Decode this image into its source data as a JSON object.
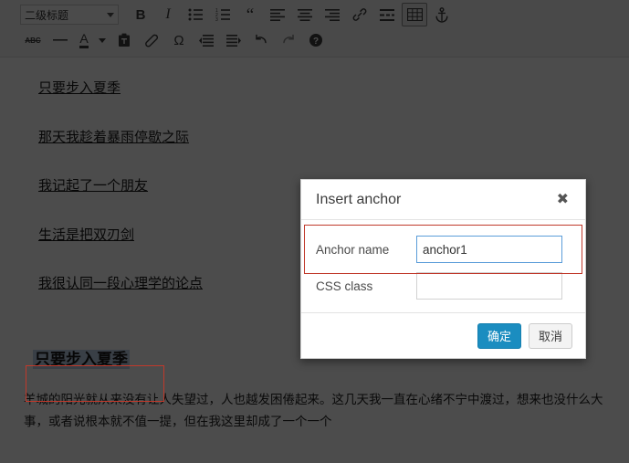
{
  "toolbar": {
    "block_format": {
      "value": "二级标题",
      "caret_icon": "chevron-down-icon"
    },
    "row1": [
      {
        "name": "bold-button",
        "label": "B",
        "icon": "bold-icon",
        "active": false
      },
      {
        "name": "italic-button",
        "label": "I",
        "icon": "italic-icon",
        "active": false
      },
      {
        "name": "bullet-list-button",
        "label": "",
        "icon": "bullet-list-icon",
        "active": false
      },
      {
        "name": "numbered-list-button",
        "label": "",
        "icon": "numbered-list-icon",
        "active": false
      },
      {
        "name": "blockquote-button",
        "label": "“",
        "icon": "blockquote-icon",
        "active": false
      },
      {
        "name": "align-left-button",
        "label": "",
        "icon": "align-left-icon",
        "active": false
      },
      {
        "name": "align-center-button",
        "label": "",
        "icon": "align-center-icon",
        "active": false
      },
      {
        "name": "align-right-button",
        "label": "",
        "icon": "align-right-icon",
        "active": false
      },
      {
        "name": "insert-link-button",
        "label": "",
        "icon": "link-icon",
        "active": false
      },
      {
        "name": "read-more-button",
        "label": "",
        "icon": "read-more-icon",
        "active": false
      },
      {
        "name": "insert-table-button",
        "label": "",
        "icon": "table-icon",
        "active": true
      },
      {
        "name": "insert-anchor-button",
        "label": "",
        "icon": "anchor-icon",
        "active": false
      }
    ],
    "row2": [
      {
        "name": "strikethrough-button",
        "label": "ABC",
        "icon": "strikethrough-icon",
        "active": false
      },
      {
        "name": "horizontal-rule-button",
        "label": "",
        "icon": "horizontal-rule-icon",
        "active": false
      },
      {
        "name": "text-color-button",
        "label": "A",
        "icon": "text-color-icon",
        "active": false
      },
      {
        "name": "text-color-caret",
        "label": "",
        "icon": "chevron-down-icon",
        "active": false
      },
      {
        "name": "paste-as-text-button",
        "label": "",
        "icon": "clipboard-icon",
        "active": false
      },
      {
        "name": "clear-formatting-button",
        "label": "",
        "icon": "eraser-icon",
        "active": false
      },
      {
        "name": "special-character-button",
        "label": "Ω",
        "icon": "omega-icon",
        "active": false
      },
      {
        "name": "outdent-button",
        "label": "",
        "icon": "outdent-icon",
        "active": false
      },
      {
        "name": "indent-button",
        "label": "",
        "icon": "indent-icon",
        "active": false
      },
      {
        "name": "undo-button",
        "label": "",
        "icon": "undo-icon",
        "active": false
      },
      {
        "name": "redo-button",
        "label": "",
        "icon": "redo-icon",
        "active": false
      },
      {
        "name": "help-button",
        "label": "?",
        "icon": "help-icon",
        "active": false
      }
    ]
  },
  "document": {
    "links": [
      "只要步入夏季",
      "那天我趁着暴雨停歇之际",
      "我记起了一个朋友",
      "生活是把双刃剑",
      "我很认同一段心理学的论点"
    ],
    "selected_heading": "只要步入夏季",
    "paragraph": "羊城的阳光就从来没有让人失望过，人也越发困倦起来。这几天我一直在心绪不宁中渡过，想来也没什么大事，或者说根本就不值一提，但在我这里却成了一个一个"
  },
  "dialog": {
    "title": "Insert anchor",
    "close_icon": "close-icon",
    "fields": [
      {
        "label": "Anchor name",
        "value": "anchor1",
        "placeholder": "",
        "focused": true
      },
      {
        "label": "CSS class",
        "value": "",
        "placeholder": "",
        "focused": false
      }
    ],
    "buttons": {
      "confirm": "确定",
      "cancel": "取消"
    }
  },
  "colors": {
    "overlay": "#4b4b4b",
    "primary_button": "#1b8dc0",
    "annotation": "#c0392b",
    "focus_border": "#5b9dd9",
    "selection": "#bfd4ec"
  }
}
